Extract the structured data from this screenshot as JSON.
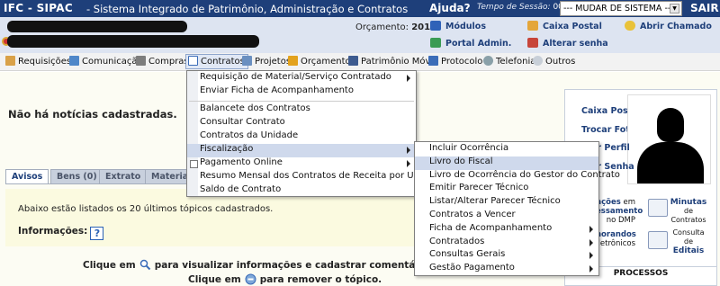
{
  "topbar": {
    "system": "IFC - SIPAC",
    "system_name": "- Sistema Integrado de Patrimônio, Administração e Contratos",
    "help": "Ajuda?",
    "session_label": "Tempo de Sessão:",
    "session_time": "00:49",
    "change_system": "--- MUDAR DE SISTEMA ---",
    "logout": "SAIR"
  },
  "header": {
    "budget_label": "Orçamento:",
    "budget_year": "2018",
    "links": {
      "modulos": "Módulos",
      "caixa_postal": "Caixa Postal",
      "abrir_chamado": "Abrir Chamado",
      "portal_admin": "Portal Admin.",
      "alterar_senha": "Alterar senha"
    }
  },
  "menubar": {
    "requisicoes": "Requisições",
    "comunicacao": "Comunicação",
    "compras": "Compras",
    "contratos": "Contratos",
    "projetos": "Projetos",
    "orcamento": "Orçamento",
    "patrimonio": "Patrimônio Móvel",
    "protocolo": "Protocolo",
    "telefonia": "Telefonia",
    "outros": "Outros"
  },
  "contratos_menu": [
    "Requisição de Material/Serviço Contratado",
    "Enviar Ficha de Acompanhamento",
    "Balancete dos Contratos",
    "Consultar Contrato",
    "Contratos da Unidade",
    "Fiscalização",
    "Pagamento Online",
    "Resumo Mensal dos Contratos de Receita por Unidade",
    "Saldo de Contrato"
  ],
  "fiscalizacao_menu": [
    "Incluir Ocorrência",
    "Livro do Fiscal",
    "Livro de Ocorrência do Gestor do Contrato",
    "Emitir Parecer Técnico",
    "Listar/Alterar Parecer Técnico",
    "Contratos a Vencer",
    "Ficha de Acompanhamento",
    "Contratados",
    "Consultas Gerais",
    "Gestão Pagamento"
  ],
  "main": {
    "no_news": "Não há notícias cadastradas.",
    "tabs": [
      "Avisos",
      "Bens (0)",
      "Extrato",
      "Material"
    ],
    "listed": "Abaixo estão listados os 20 últimos tópicos cadastrados.",
    "info_label": "Informações:",
    "info_icon": "?",
    "click1_pre": "Clique em",
    "click1_post": "para visualizar informações e cadastrar comentário s",
    "click2_pre": "Clique em",
    "click2_post": "para remover o tópico."
  },
  "right_panel": {
    "caixa_postal": "Caixa Postal",
    "trocar_foto": "Trocar Foto",
    "perfil": "ar Perfil",
    "senha": "ar Senha",
    "acoes_a": "ações",
    "acoes_b": "em",
    "acoes_c": "essamento",
    "acoes_d": "no DMP",
    "minutas": "Minutas",
    "minutas_de": "de",
    "minutas_contratos": "Contratos",
    "norandos": "norandos",
    "eletronicos": "letrônicos",
    "consulta": "Consulta",
    "consulta_de": "de",
    "editais": "Editais",
    "processos": "PROCESSOS"
  }
}
